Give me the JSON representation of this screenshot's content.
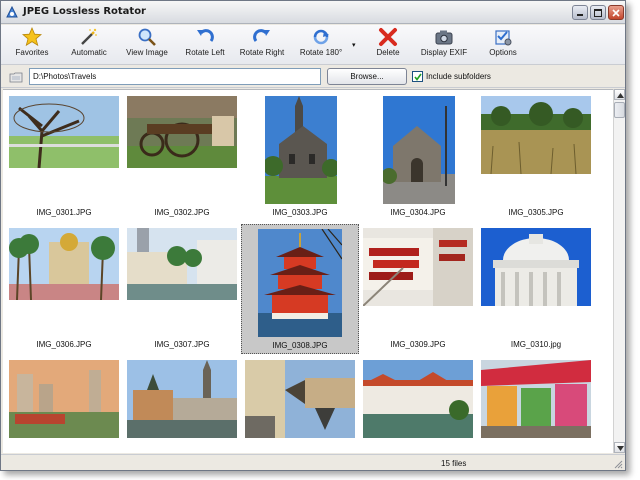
{
  "window": {
    "title": "JPEG Lossless Rotator"
  },
  "toolbar": {
    "buttons": [
      {
        "label": "Favorites",
        "icon": "star-icon"
      },
      {
        "label": "Automatic",
        "icon": "magic-wand-icon"
      },
      {
        "label": "View Image",
        "icon": "magnifier-icon"
      },
      {
        "label": "Rotate Left",
        "icon": "rotate-left-icon"
      },
      {
        "label": "Rotate Right",
        "icon": "rotate-right-icon"
      },
      {
        "label": "Rotate 180°",
        "icon": "rotate-180-icon"
      },
      {
        "label": "Delete",
        "icon": "delete-x-icon"
      },
      {
        "label": "Display EXIF",
        "icon": "camera-icon"
      },
      {
        "label": "Options",
        "icon": "options-icon"
      }
    ]
  },
  "pathbar": {
    "path": "D:\\Photos\\Travels",
    "browse_label": "Browse...",
    "include_subfolders_label": "Include subfolders",
    "include_subfolders_checked": true
  },
  "thumbnails": [
    {
      "name": "IMG_0301.JPG",
      "orientation": "landscape"
    },
    {
      "name": "IMG_0302.JPG",
      "orientation": "landscape"
    },
    {
      "name": "IMG_0303.JPG",
      "orientation": "portrait"
    },
    {
      "name": "IMG_0304.JPG",
      "orientation": "portrait"
    },
    {
      "name": "IMG_0305.JPG",
      "orientation": "landscape"
    },
    {
      "name": "IMG_0306.JPG",
      "orientation": "landscape"
    },
    {
      "name": "IMG_0307.JPG",
      "orientation": "landscape"
    },
    {
      "name": "IMG_0308.JPG",
      "orientation": "portrait",
      "selected": true
    },
    {
      "name": "IMG_0309.JPG",
      "orientation": "landscape"
    },
    {
      "name": "IMG_0310.jpg",
      "orientation": "landscape"
    },
    {
      "name": "",
      "orientation": "landscape"
    },
    {
      "name": "",
      "orientation": "landscape"
    },
    {
      "name": "",
      "orientation": "landscape"
    },
    {
      "name": "",
      "orientation": "landscape"
    },
    {
      "name": "",
      "orientation": "landscape"
    }
  ],
  "status": {
    "file_count": "15 files"
  },
  "colors": {
    "accent": "#3a6fc4",
    "selection": "#c8c8c8"
  }
}
